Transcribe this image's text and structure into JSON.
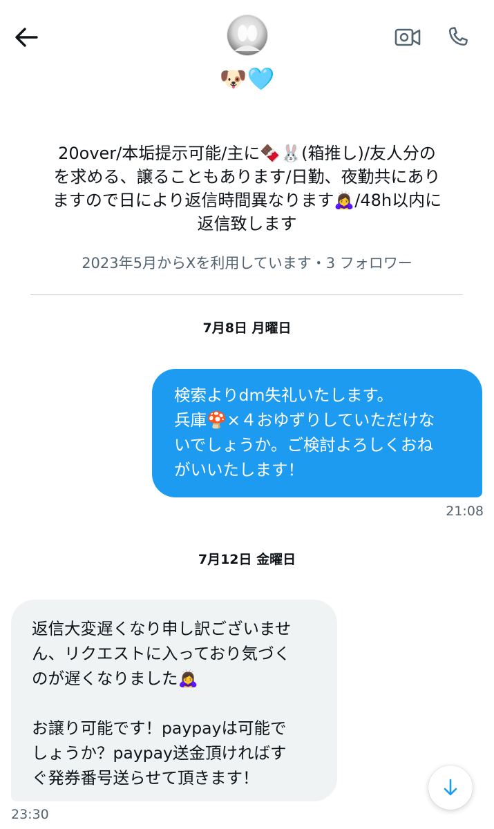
{
  "header": {
    "display_name": "🐶🩵",
    "icons": [
      "back-arrow-icon",
      "video-call-icon",
      "phone-call-icon"
    ]
  },
  "profile": {
    "bio_lines": [
      "20over/本垢提示可能/主に🍫🐰(箱推し)/友人分の",
      "を求める、譲ることもあります/日勤、夜勤共にあり",
      "ますので日により返信時間異なります🙇‍♀️/48h以内に",
      "返信致します"
    ],
    "joined": "2023年5月からXを利用しています・3 フォロワー"
  },
  "conversation": {
    "sections": [
      {
        "date": "7月8日 月曜日",
        "message": {
          "direction": "sent",
          "lines": [
            "検索よりdm失礼いたします。",
            "兵庫🍄×４おゆずりしていただけな",
            "いでしょうか。ご検討よろしくおね",
            "がいいたします！"
          ],
          "time": "21:08"
        }
      },
      {
        "date": "7月12日 金曜日",
        "message": {
          "direction": "received",
          "lines": [
            "返信大変遅くなり申し訳ございませ",
            "ん、リクエストに入っており気づく",
            "のが遅くなりました🙇‍♀️",
            "",
            "お譲り可能です！paypayは可能で",
            "しょうか？paypay送金頂ければす",
            "ぐ発券番号送らせて頂きます！"
          ],
          "time": "23:30"
        }
      }
    ]
  },
  "colors": {
    "accent": "#1d9bf0",
    "received_bubble": "#eff3f4",
    "secondary_text": "#536471",
    "icon_gray": "#536471"
  }
}
